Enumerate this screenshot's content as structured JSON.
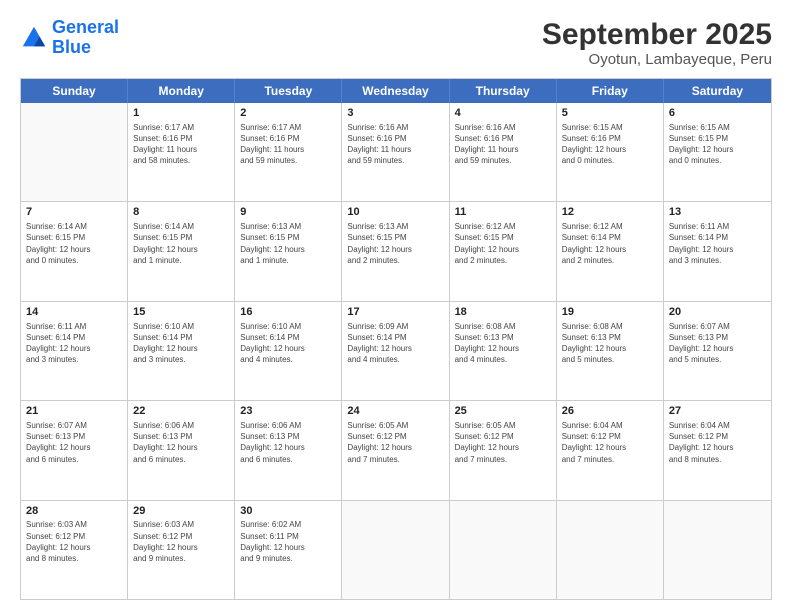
{
  "logo": {
    "line1": "General",
    "line2": "Blue"
  },
  "title": "September 2025",
  "subtitle": "Oyotun, Lambayeque, Peru",
  "days": [
    "Sunday",
    "Monday",
    "Tuesday",
    "Wednesday",
    "Thursday",
    "Friday",
    "Saturday"
  ],
  "rows": [
    [
      {
        "day": "",
        "info": ""
      },
      {
        "day": "1",
        "info": "Sunrise: 6:17 AM\nSunset: 6:16 PM\nDaylight: 11 hours\nand 58 minutes."
      },
      {
        "day": "2",
        "info": "Sunrise: 6:17 AM\nSunset: 6:16 PM\nDaylight: 11 hours\nand 59 minutes."
      },
      {
        "day": "3",
        "info": "Sunrise: 6:16 AM\nSunset: 6:16 PM\nDaylight: 11 hours\nand 59 minutes."
      },
      {
        "day": "4",
        "info": "Sunrise: 6:16 AM\nSunset: 6:16 PM\nDaylight: 11 hours\nand 59 minutes."
      },
      {
        "day": "5",
        "info": "Sunrise: 6:15 AM\nSunset: 6:16 PM\nDaylight: 12 hours\nand 0 minutes."
      },
      {
        "day": "6",
        "info": "Sunrise: 6:15 AM\nSunset: 6:15 PM\nDaylight: 12 hours\nand 0 minutes."
      }
    ],
    [
      {
        "day": "7",
        "info": "Sunrise: 6:14 AM\nSunset: 6:15 PM\nDaylight: 12 hours\nand 0 minutes."
      },
      {
        "day": "8",
        "info": "Sunrise: 6:14 AM\nSunset: 6:15 PM\nDaylight: 12 hours\nand 1 minute."
      },
      {
        "day": "9",
        "info": "Sunrise: 6:13 AM\nSunset: 6:15 PM\nDaylight: 12 hours\nand 1 minute."
      },
      {
        "day": "10",
        "info": "Sunrise: 6:13 AM\nSunset: 6:15 PM\nDaylight: 12 hours\nand 2 minutes."
      },
      {
        "day": "11",
        "info": "Sunrise: 6:12 AM\nSunset: 6:15 PM\nDaylight: 12 hours\nand 2 minutes."
      },
      {
        "day": "12",
        "info": "Sunrise: 6:12 AM\nSunset: 6:14 PM\nDaylight: 12 hours\nand 2 minutes."
      },
      {
        "day": "13",
        "info": "Sunrise: 6:11 AM\nSunset: 6:14 PM\nDaylight: 12 hours\nand 3 minutes."
      }
    ],
    [
      {
        "day": "14",
        "info": "Sunrise: 6:11 AM\nSunset: 6:14 PM\nDaylight: 12 hours\nand 3 minutes."
      },
      {
        "day": "15",
        "info": "Sunrise: 6:10 AM\nSunset: 6:14 PM\nDaylight: 12 hours\nand 3 minutes."
      },
      {
        "day": "16",
        "info": "Sunrise: 6:10 AM\nSunset: 6:14 PM\nDaylight: 12 hours\nand 4 minutes."
      },
      {
        "day": "17",
        "info": "Sunrise: 6:09 AM\nSunset: 6:14 PM\nDaylight: 12 hours\nand 4 minutes."
      },
      {
        "day": "18",
        "info": "Sunrise: 6:08 AM\nSunset: 6:13 PM\nDaylight: 12 hours\nand 4 minutes."
      },
      {
        "day": "19",
        "info": "Sunrise: 6:08 AM\nSunset: 6:13 PM\nDaylight: 12 hours\nand 5 minutes."
      },
      {
        "day": "20",
        "info": "Sunrise: 6:07 AM\nSunset: 6:13 PM\nDaylight: 12 hours\nand 5 minutes."
      }
    ],
    [
      {
        "day": "21",
        "info": "Sunrise: 6:07 AM\nSunset: 6:13 PM\nDaylight: 12 hours\nand 6 minutes."
      },
      {
        "day": "22",
        "info": "Sunrise: 6:06 AM\nSunset: 6:13 PM\nDaylight: 12 hours\nand 6 minutes."
      },
      {
        "day": "23",
        "info": "Sunrise: 6:06 AM\nSunset: 6:13 PM\nDaylight: 12 hours\nand 6 minutes."
      },
      {
        "day": "24",
        "info": "Sunrise: 6:05 AM\nSunset: 6:12 PM\nDaylight: 12 hours\nand 7 minutes."
      },
      {
        "day": "25",
        "info": "Sunrise: 6:05 AM\nSunset: 6:12 PM\nDaylight: 12 hours\nand 7 minutes."
      },
      {
        "day": "26",
        "info": "Sunrise: 6:04 AM\nSunset: 6:12 PM\nDaylight: 12 hours\nand 7 minutes."
      },
      {
        "day": "27",
        "info": "Sunrise: 6:04 AM\nSunset: 6:12 PM\nDaylight: 12 hours\nand 8 minutes."
      }
    ],
    [
      {
        "day": "28",
        "info": "Sunrise: 6:03 AM\nSunset: 6:12 PM\nDaylight: 12 hours\nand 8 minutes."
      },
      {
        "day": "29",
        "info": "Sunrise: 6:03 AM\nSunset: 6:12 PM\nDaylight: 12 hours\nand 9 minutes."
      },
      {
        "day": "30",
        "info": "Sunrise: 6:02 AM\nSunset: 6:11 PM\nDaylight: 12 hours\nand 9 minutes."
      },
      {
        "day": "",
        "info": ""
      },
      {
        "day": "",
        "info": ""
      },
      {
        "day": "",
        "info": ""
      },
      {
        "day": "",
        "info": ""
      }
    ]
  ]
}
